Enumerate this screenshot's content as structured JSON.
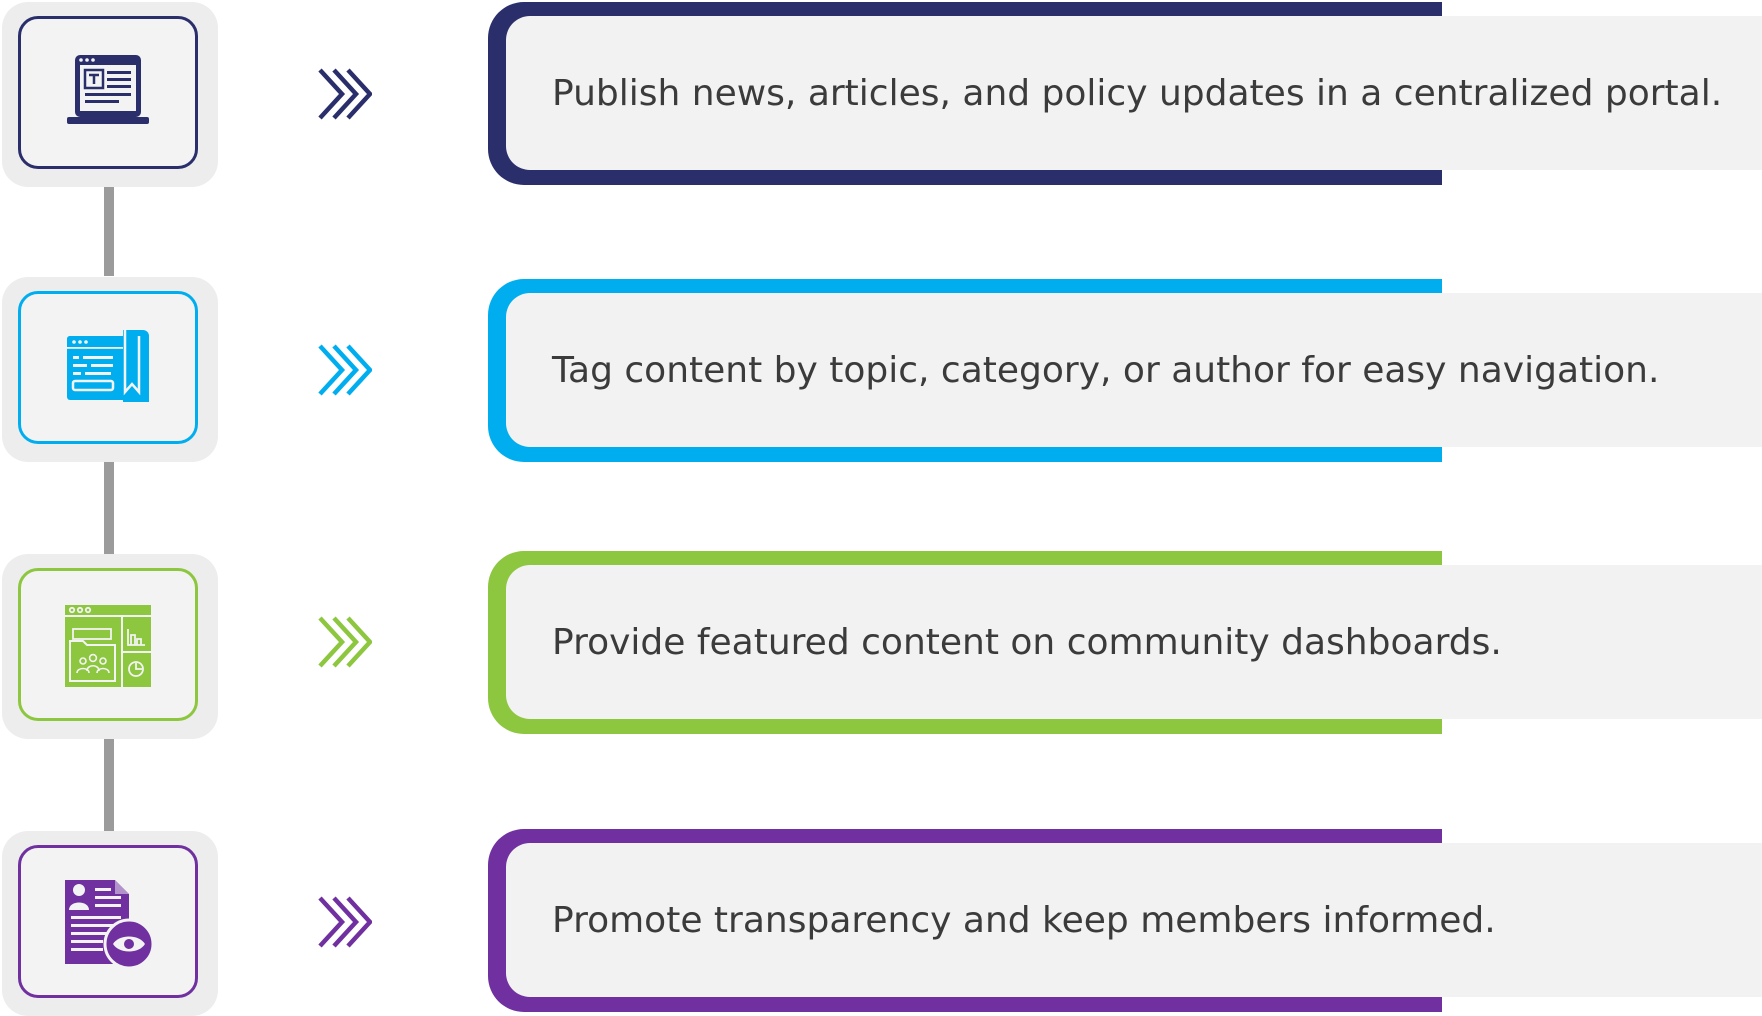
{
  "steps": [
    {
      "icon": "news-portal-laptop-icon",
      "color": "#2a2f6b",
      "text": "Publish news, articles, and policy updates in a centralized portal."
    },
    {
      "icon": "tagged-web-page-bookmark-icon",
      "color": "#00aeef",
      "text": "Tag content by topic, category, or author for easy navigation."
    },
    {
      "icon": "community-dashboard-icon",
      "color": "#8dc63f",
      "text": "Provide featured content on community dashboards."
    },
    {
      "icon": "transparency-document-eye-icon",
      "color": "#7030a0",
      "text": "Promote transparency and keep members informed."
    }
  ]
}
